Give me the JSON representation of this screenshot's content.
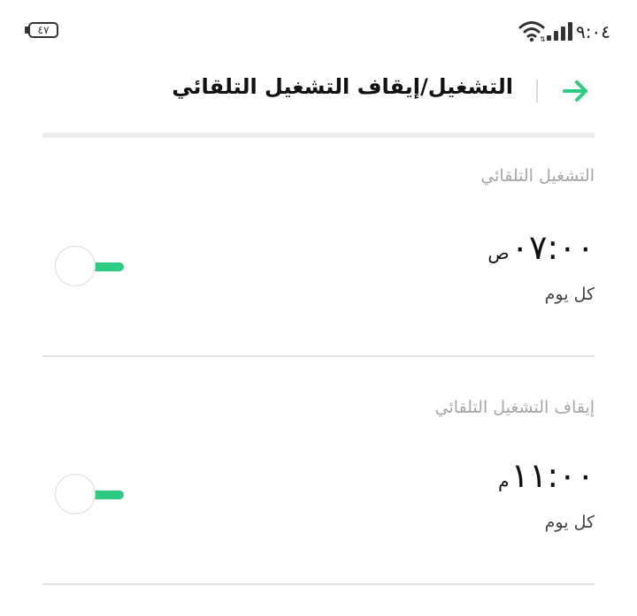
{
  "status_bar": {
    "time": "٩:٠٤",
    "battery_level": "٤٧",
    "signal_icon": "cellular-signal-icon",
    "wifi_icon": "wifi-icon"
  },
  "header": {
    "title": "التشغيل/إيقاف التشغيل التلقائي",
    "back_icon": "arrow-right-icon",
    "accent_color": "#2ecb82"
  },
  "auto_on": {
    "label": "التشغيل التلقائي",
    "time": "٠٧:٠٠",
    "ampm": "ص",
    "repeat": "كل يوم",
    "enabled": true
  },
  "auto_off": {
    "label": "إيقاف التشغيل التلقائي",
    "time": "١١:٠٠",
    "ampm": "م",
    "repeat": "كل يوم",
    "enabled": true
  }
}
